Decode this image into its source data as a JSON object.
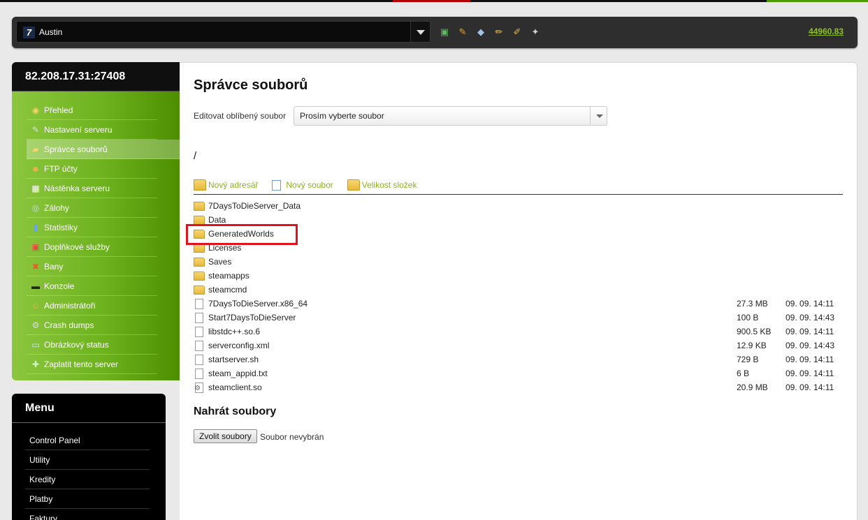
{
  "header": {
    "server_name": "Austin",
    "credit": "44960.83",
    "icons": [
      "add-server-icon",
      "tools-icon",
      "tag-icon",
      "pencil-icon",
      "edit-icon",
      "ftp-icon"
    ]
  },
  "sidebar": {
    "ip": "82.208.17.31:27408",
    "items": [
      {
        "label": "Přehled",
        "icon": "magnifier-icon"
      },
      {
        "label": "Nastavení serveru",
        "icon": "wrench-icon"
      },
      {
        "label": "Správce souborů",
        "icon": "folder-icon",
        "active": true
      },
      {
        "label": "FTP účty",
        "icon": "ftp-user-icon"
      },
      {
        "label": "Nástěnka serveru",
        "icon": "board-icon"
      },
      {
        "label": "Zálohy",
        "icon": "disc-icon"
      },
      {
        "label": "Statistiky",
        "icon": "chart-icon"
      },
      {
        "label": "Doplňkové služby",
        "icon": "gift-icon"
      },
      {
        "label": "Bany",
        "icon": "ban-icon"
      },
      {
        "label": "Konzole",
        "icon": "console-icon"
      },
      {
        "label": "Administrátoři",
        "icon": "admin-icon"
      },
      {
        "label": "Crash dumps",
        "icon": "gear-icon"
      },
      {
        "label": "Obrázkový status",
        "icon": "image-icon"
      },
      {
        "label": "Zaplatit tento server",
        "icon": "payment-icon"
      }
    ]
  },
  "menu": {
    "title": "Menu",
    "items": [
      "Control Panel",
      "Utility",
      "Kredity",
      "Platby",
      "Faktury"
    ]
  },
  "main": {
    "title": "Správce souborů",
    "fav_label": "Editovat oblíbený soubor",
    "fav_placeholder": "Prosím vyberte soubor",
    "path": "/",
    "actions": [
      "Nový adresář",
      "Nový soubor",
      "Velikost složek"
    ],
    "folders": [
      "7DaysToDieServer_Data",
      "Data",
      "GeneratedWorlds",
      "Licenses",
      "Saves",
      "steamapps",
      "steamcmd"
    ],
    "files": [
      {
        "name": "7DaysToDieServer.x86_64",
        "size": "27.3 MB",
        "date": "09. 09. 14:11"
      },
      {
        "name": "Start7DaysToDieServer",
        "size": "100 B",
        "date": "09. 09. 14:43"
      },
      {
        "name": "libstdc++.so.6",
        "size": "900.5 KB",
        "date": "09. 09. 14:11"
      },
      {
        "name": "serverconfig.xml",
        "size": "12.9 KB",
        "date": "09. 09. 14:43"
      },
      {
        "name": "startserver.sh",
        "size": "729 B",
        "date": "09. 09. 14:11"
      },
      {
        "name": "steam_appid.txt",
        "size": "6 B",
        "date": "09. 09. 14:11"
      },
      {
        "name": "steamclient.so",
        "size": "20.9 MB",
        "date": "09. 09. 14:11"
      }
    ],
    "upload_title": "Nahrát soubory",
    "upload_button": "Zvolit soubory",
    "upload_status": "Soubor nevybrán"
  },
  "colors": {
    "accent_green": "#8ec21c",
    "highlight_red": "#e0141e"
  }
}
